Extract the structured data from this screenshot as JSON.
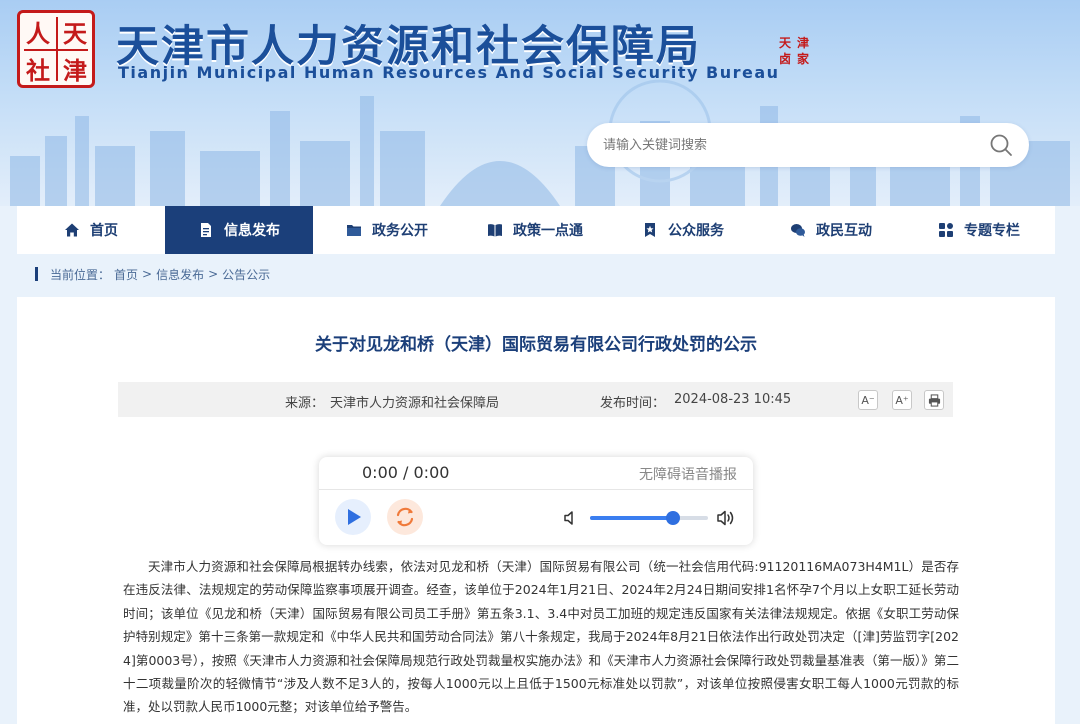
{
  "header": {
    "seal_chars": [
      "人",
      "天",
      "社",
      "津"
    ],
    "title": "天津市人力资源和社会保障局",
    "subtitle": "Tianjin Municipal Human Resources And Social Security Bureau",
    "stamp_chars": [
      "天",
      "津",
      "卤",
      "家"
    ],
    "search": {
      "placeholder": "请输入关键词搜索"
    }
  },
  "nav": {
    "items": [
      {
        "label": "首页",
        "icon": "home-icon"
      },
      {
        "label": "信息发布",
        "icon": "document-icon",
        "active": true
      },
      {
        "label": "政务公开",
        "icon": "folder-icon"
      },
      {
        "label": "政策一点通",
        "icon": "book-icon"
      },
      {
        "label": "公众服务",
        "icon": "bookmark-star-icon"
      },
      {
        "label": "政民互动",
        "icon": "chat-icon"
      },
      {
        "label": "专题专栏",
        "icon": "grid-icon"
      }
    ]
  },
  "breadcrumb": {
    "prefix": "当前位置：",
    "items": [
      "首页",
      "信息发布",
      "公告公示"
    ],
    "separator": ">"
  },
  "article": {
    "title": "关于对见龙和桥（天津）国际贸易有限公司行政处罚的公示",
    "source_label": "来源：",
    "source": "天津市人力资源和社会保障局",
    "time_label": "发布时间：",
    "time": "2024-08-23 10:45",
    "tools": {
      "font_smaller": "A⁻",
      "font_larger": "A⁺"
    },
    "body": "天津市人力资源和社会保障局根据转办线索，依法对见龙和桥（天津）国际贸易有限公司（统一社会信用代码:91120116MA073H4M1L）是否存在违反法律、法规规定的劳动保障监察事项展开调查。经查，该单位于2024年1月21日、2024年2月24日期间安排1名怀孕7个月以上女职工延长劳动时间；该单位《见龙和桥（天津）国际贸易有限公司员工手册》第五条3.1、3.4中对员工加班的规定违反国家有关法律法规规定。依据《女职工劳动保护特别规定》第十三条第一款规定和《中华人民共和国劳动合同法》第八十条规定，我局于2024年8月21日依法作出行政处罚决定（[津]劳监罚字[2024]第0003号），按照《天津市人力资源和社会保障局规范行政处罚裁量权实施办法》和《天津市人力资源社会保障行政处罚裁量基准表（第一版）》第二十二项裁量阶次的轻微情节“涉及人数不足3人的，按每人1000元以上且低于1500元标准处以罚款”，对该单位按照侵害女职工每人1000元罚款的标准，处以罚款人民币1000元整；对该单位给予警告。"
  },
  "player": {
    "time": "0:00 / 0:00",
    "label": "无障碍语音播报",
    "volume": 0.7
  },
  "colors": {
    "primary": "#1b3f7a",
    "title_blue": "#1b4f9a",
    "seal_red": "#c41a1a"
  }
}
